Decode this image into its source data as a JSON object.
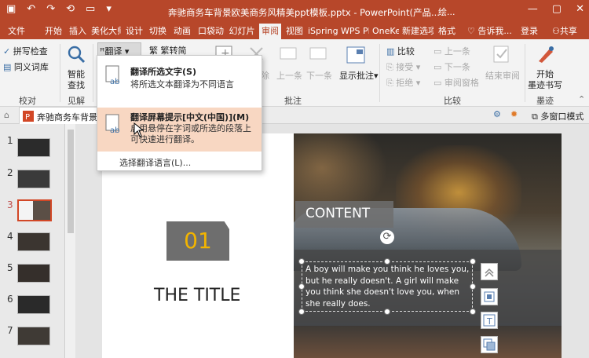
{
  "titlebar": {
    "doc_title": "奔驰商务车背景欧美商务风精美ppt模板.pptx - PowerPoint(产品...",
    "extra": "绘...",
    "qat": [
      "💾",
      "↶",
      "↷",
      "⟳",
      "🖥",
      "▾"
    ],
    "window_controls": [
      "—",
      "▢",
      "✕"
    ]
  },
  "tabs": [
    "文件",
    "开始",
    "插入",
    "美化大师",
    "设计",
    "切换",
    "动画",
    "口袋动画",
    "幻灯片",
    "审阅",
    "视图",
    "iSpring",
    "WPS PDF",
    "OneKey",
    "新建选项卡",
    "格式"
  ],
  "active_tab": "审阅",
  "tell_me": "告诉我...",
  "login": "登录",
  "share": "共享",
  "ribbon": {
    "spell": "拼写检查",
    "thesaurus": "同义词库",
    "proofing_group": "校对",
    "smart_lookup_1": "智能",
    "smart_lookup_2": "查找",
    "insights_group": "见解",
    "translate": "翻译",
    "trad_simp": "繁转简",
    "delete": "删除",
    "prev": "上一条",
    "next": "下一条",
    "show_comments": "显示批注",
    "comments_group": "批注",
    "compare": "比较",
    "accept": "接受",
    "reject": "拒绝",
    "prev2": "上一条",
    "next2": "下一条",
    "review_pane": "审阅窗格",
    "end_review": "结束审阅",
    "compare_group": "比较",
    "ink_1": "开始",
    "ink_2": "墨迹书写",
    "ink_group": "墨迹"
  },
  "dropdown": {
    "item1_title": "翻译所选文字(S)",
    "item1_desc": "将所选文本翻译为不同语言",
    "item2_title": "翻译屏幕提示[中文(中国)](M)",
    "item2_desc": "启用悬停在字词或所选的段落上可快速进行翻译。",
    "choose_lang": "选择翻译语言(L)..."
  },
  "doc_tab": "奔驰商务车背景",
  "multi_window": "多窗口模式",
  "thumbnails": [
    "1",
    "2",
    "3",
    "4",
    "5",
    "6",
    "7"
  ],
  "selected_slide": "3",
  "slide": {
    "number": "01",
    "title": "THE TITLE",
    "content_label": "CONTENT",
    "body": "A boy will make you think he loves you, but he really doesn't. A girl will make you think she doesn't love you, when she really does."
  },
  "colors": {
    "accent": "#b7472a",
    "highlight": "#f8d7c2",
    "number": "#f2b400"
  }
}
